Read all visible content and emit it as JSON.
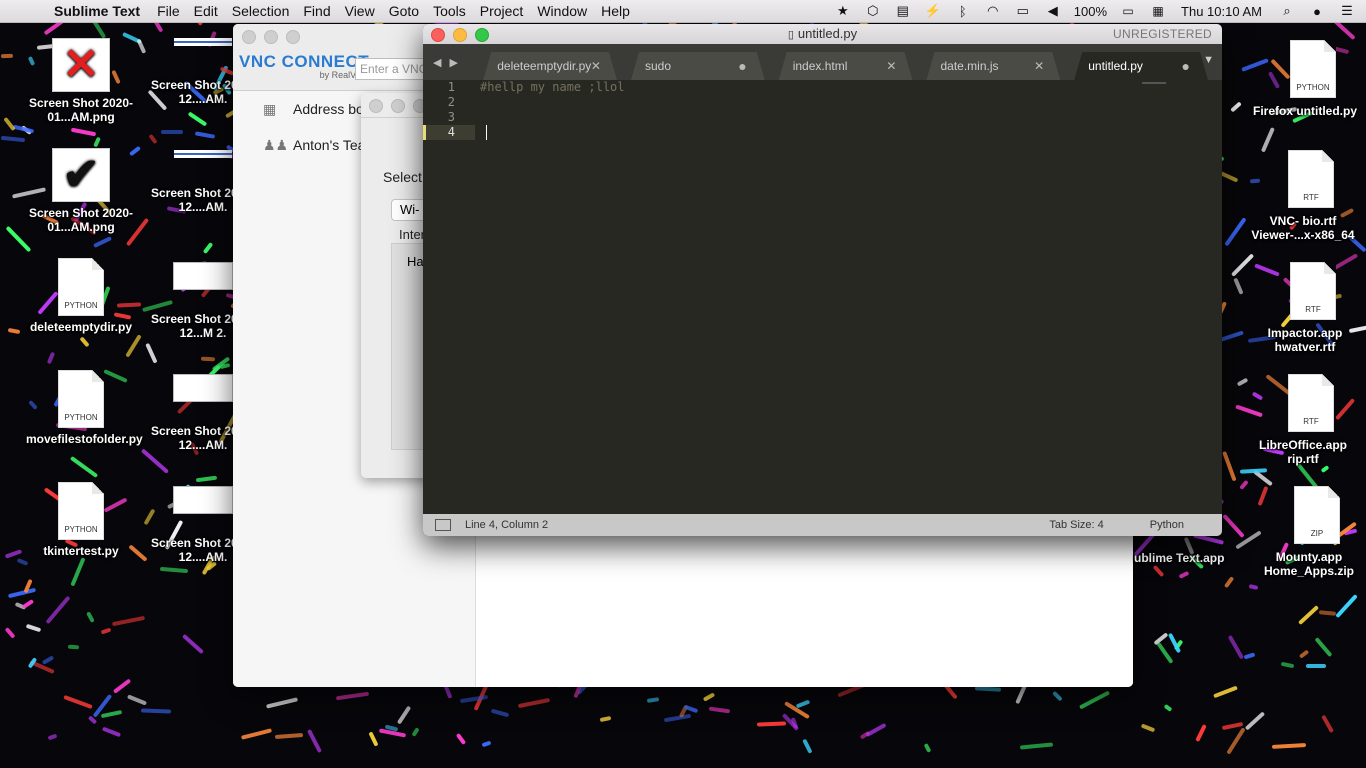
{
  "menubar": {
    "app_name": "Sublime Text",
    "menus": [
      "File",
      "Edit",
      "Selection",
      "Find",
      "View",
      "Goto",
      "Tools",
      "Project",
      "Window",
      "Help"
    ],
    "battery": "100%",
    "clock": "Thu 10:10 AM"
  },
  "desktop_left": [
    {
      "label": "Screen Shot 2020-01...AM.png",
      "kind": "shot-x"
    },
    {
      "label": "Screen Shot 2019-12....AM.",
      "kind": "line"
    },
    {
      "label": "Screen Shot 2020-01...AM.png",
      "kind": "shot-check"
    },
    {
      "label": "Screen Shot 2019-12....AM.",
      "kind": "line"
    },
    {
      "label": "deleteemptydir.py",
      "kind": "file",
      "ftype": "PYTHON"
    },
    {
      "label": "Screen Shot 2019-12...M 2.",
      "kind": "wide"
    },
    {
      "label": "movefilestofolder.py",
      "kind": "file",
      "ftype": "PYTHON"
    },
    {
      "label": "Screen Shot 2019-12....AM.",
      "kind": "wide"
    },
    {
      "label": "tkintertest.py",
      "kind": "file",
      "ftype": "PYTHON"
    },
    {
      "label": "Screen Shot 2019-12....AM.",
      "kind": "wide"
    }
  ],
  "desktop_right": [
    {
      "label": "Firefox untitled.py",
      "ftype": "PYTHON"
    },
    {
      "label": "VNC- bio.rtf Viewer-...x-x86_64",
      "ftype": "RTF"
    },
    {
      "label": "Impactor.app hwatver.rtf",
      "ftype": "RTF"
    },
    {
      "label": "LibreOffice.app rip.rtf",
      "ftype": "RTF"
    },
    {
      "label": "Mounty.app Home_Apps.zip",
      "ftype": "ZIP"
    }
  ],
  "desktop_extra": {
    "sublime_label": "ublime Text.app"
  },
  "vnc": {
    "logo": "VNC CONNECT",
    "logo_sub": "by RealVNC",
    "search_placeholder": "Enter a VNC",
    "sidebar": [
      {
        "label": "Address bo",
        "icon": "grid-icon"
      },
      {
        "label": "Anton's Tea",
        "icon": "team-icon"
      }
    ]
  },
  "sheet": {
    "select_label": "Select",
    "select_value": "Wi-",
    "inter_label": "Inter",
    "ha_label": "Ha"
  },
  "sublime": {
    "title": "untitled.py",
    "unregistered": "UNREGISTERED",
    "tabs": [
      {
        "label": "deleteemptydir.py",
        "state": "close"
      },
      {
        "label": "sudo",
        "state": "dirty"
      },
      {
        "label": "index.html",
        "state": "close"
      },
      {
        "label": "date.min.js",
        "state": "close"
      },
      {
        "label": "untitled.py",
        "state": "dirty",
        "active": true
      }
    ],
    "line_numbers": [
      "1",
      "2",
      "3",
      "4"
    ],
    "code_lines": [
      "#hellp my name ;llol",
      "",
      "",
      ""
    ],
    "status_position": "Line 4, Column 2",
    "status_tab_size": "Tab Size: 4",
    "status_syntax": "Python"
  },
  "colors": {
    "editor_bg": "#272822",
    "comment": "#75715e",
    "accent_blue": "#2a7bd1"
  }
}
